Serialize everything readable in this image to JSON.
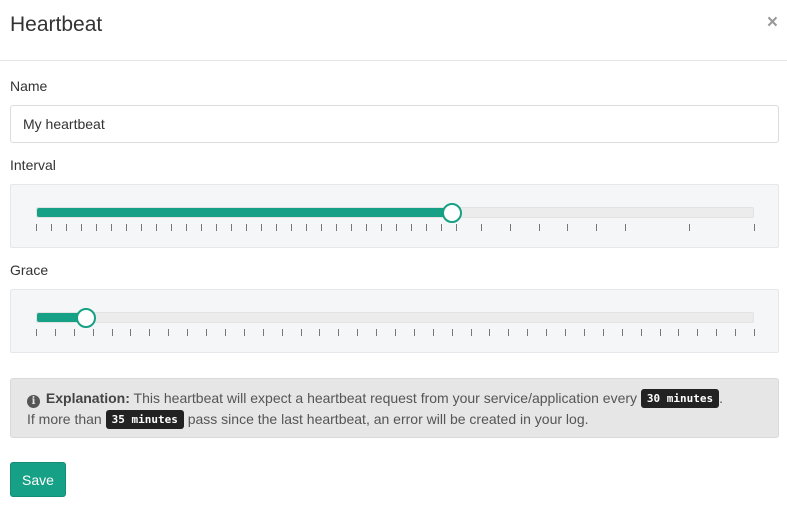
{
  "dialog": {
    "title": "Heartbeat",
    "close_label": "×"
  },
  "name_field": {
    "label": "Name",
    "value": "My heartbeat"
  },
  "interval": {
    "label": "Interval",
    "value_fraction": 0.58,
    "tick_count": 38
  },
  "grace": {
    "label": "Grace",
    "value_fraction": 0.068,
    "tick_count": 39
  },
  "explanation": {
    "icon": "info-circle-icon",
    "bold": "Explanation:",
    "text_1": "This heartbeat will expect a heartbeat request from your service/application every",
    "interval_code": "30 minutes",
    "text_2": ".",
    "text_3": "If more than",
    "grace_code": "35 minutes",
    "text_4": "pass since the last heartbeat, an error will be created in your log."
  },
  "save_label": "Save",
  "colors": {
    "accent": "#16a085",
    "code_bg": "#222222"
  }
}
